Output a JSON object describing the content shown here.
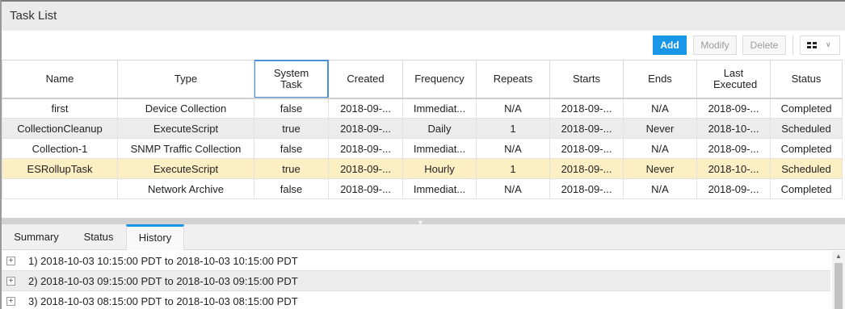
{
  "window": {
    "title": "Task List"
  },
  "toolbar": {
    "add_label": "Add",
    "modify_label": "Modify",
    "delete_label": "Delete",
    "view_icon": "grid-icon"
  },
  "table": {
    "columns": [
      "Name",
      "Type",
      "System Task",
      "Created",
      "Frequency",
      "Repeats",
      "Starts",
      "Ends",
      "Last Executed",
      "Status"
    ],
    "rows": [
      [
        "first",
        "Device Collection",
        "false",
        "2018-09-...",
        "Immediat...",
        "N/A",
        "2018-09-...",
        "N/A",
        "2018-09-...",
        "Completed"
      ],
      [
        "CollectionCleanup",
        "ExecuteScript",
        "true",
        "2018-09-...",
        "Daily",
        "1",
        "2018-09-...",
        "Never",
        "2018-10-...",
        "Scheduled"
      ],
      [
        "Collection-1",
        "SNMP Traffic Collection",
        "false",
        "2018-09-...",
        "Immediat...",
        "N/A",
        "2018-09-...",
        "N/A",
        "2018-09-...",
        "Completed"
      ],
      [
        "ESRollupTask",
        "ExecuteScript",
        "true",
        "2018-09-...",
        "Hourly",
        "1",
        "2018-09-...",
        "Never",
        "2018-10-...",
        "Scheduled"
      ],
      [
        "",
        "Network Archive",
        "false",
        "2018-09-...",
        "Immediat...",
        "N/A",
        "2018-09-...",
        "N/A",
        "2018-09-...",
        "Completed"
      ]
    ]
  },
  "tabs": [
    {
      "label": "Summary"
    },
    {
      "label": "Status"
    },
    {
      "label": "History",
      "active": true
    }
  ],
  "history": [
    "1) 2018-10-03 10:15:00 PDT to 2018-10-03 10:15:00 PDT",
    "2) 2018-10-03 09:15:00 PDT to 2018-10-03 09:15:00 PDT",
    "3) 2018-10-03 08:15:00 PDT to 2018-10-03 08:15:00 PDT"
  ],
  "colors": {
    "accent": "#1a96e8",
    "selected_row": "#fcefc4",
    "alt_row": "#ececec"
  }
}
